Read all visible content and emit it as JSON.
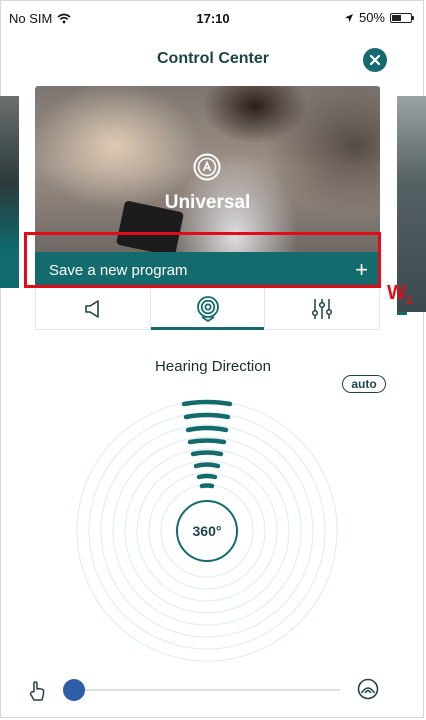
{
  "status_bar": {
    "carrier": "No SIM",
    "time": "17:10",
    "battery": "50%",
    "battery_level": 0.5
  },
  "header": {
    "title": "Control Center",
    "close_icon": "close-icon"
  },
  "program_card": {
    "name": "Universal",
    "icon": "program-a-icon",
    "save_label": "Save a new program",
    "save_icon": "plus-icon",
    "plus_glyph": "+"
  },
  "annotation": {
    "label": "W",
    "subscript": "1",
    "color": "#e30b17"
  },
  "tabs": [
    {
      "icon": "volume-icon",
      "active": false
    },
    {
      "icon": "hearing-direction-icon",
      "active": true
    },
    {
      "icon": "equalizer-icon",
      "active": false
    }
  ],
  "hearing_direction": {
    "title": "Hearing Direction",
    "auto_label": "auto",
    "center_label": "360°"
  },
  "slider": {
    "left_icon": "touch-icon",
    "right_icon": "surroundings-icon",
    "value": 0.0
  },
  "colors": {
    "accent": "#136b6e",
    "title_text": "#1d4446",
    "slider_thumb": "#2f5ea8",
    "highlight": "#e30b17"
  }
}
